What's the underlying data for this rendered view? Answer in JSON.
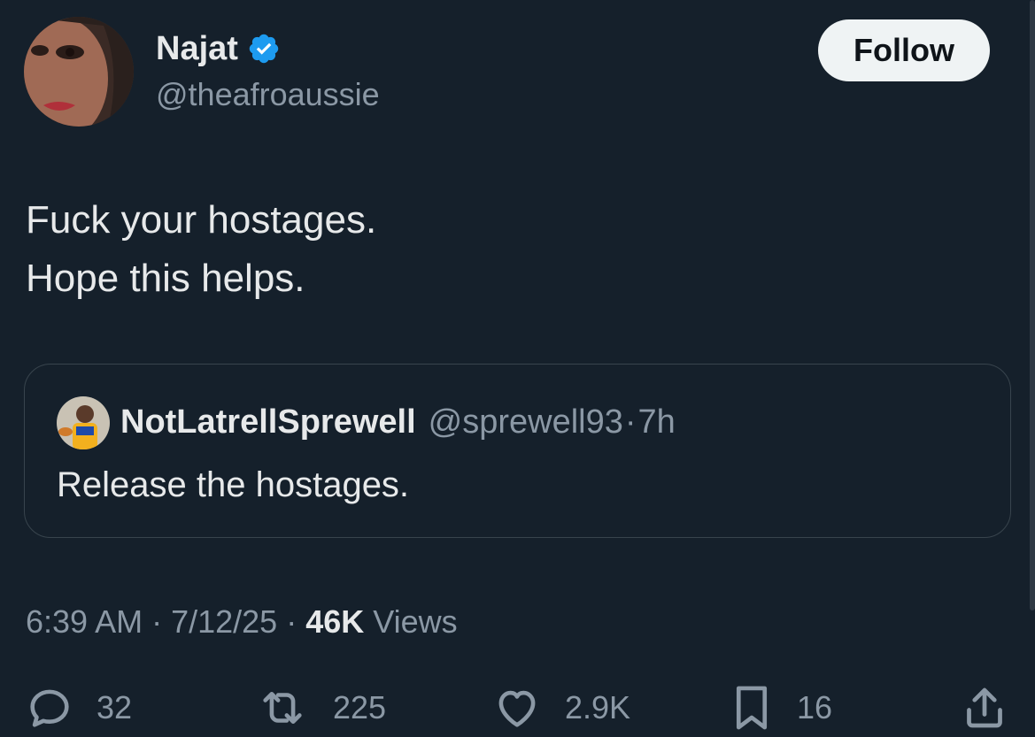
{
  "author": {
    "name": "Najat",
    "handle": "@theafroaussie"
  },
  "follow_label": "Follow",
  "tweet": {
    "text": "Fuck your hostages.\nHope this helps."
  },
  "quote": {
    "name": "NotLatrellSprewell",
    "handle": "@sprewell93",
    "separator": "·",
    "time": "7h",
    "text": "Release the hostages."
  },
  "meta": {
    "time": "6:39 AM",
    "sep1": "·",
    "date": "7/12/25",
    "sep2": "·",
    "views_count": "46K",
    "views_label": "Views"
  },
  "actions": {
    "replies": "32",
    "reposts": "225",
    "likes": "2.9K",
    "bookmarks": "16"
  },
  "icons": {
    "verified": "verified-badge-icon",
    "reply": "reply-icon",
    "repost": "repost-icon",
    "like": "heart-icon",
    "bookmark": "bookmark-icon",
    "share": "share-icon"
  },
  "colors": {
    "background": "#15202b",
    "text": "#e7e9ea",
    "secondary": "#8b98a5",
    "verified": "#1d9bf0",
    "border": "#38444d"
  }
}
